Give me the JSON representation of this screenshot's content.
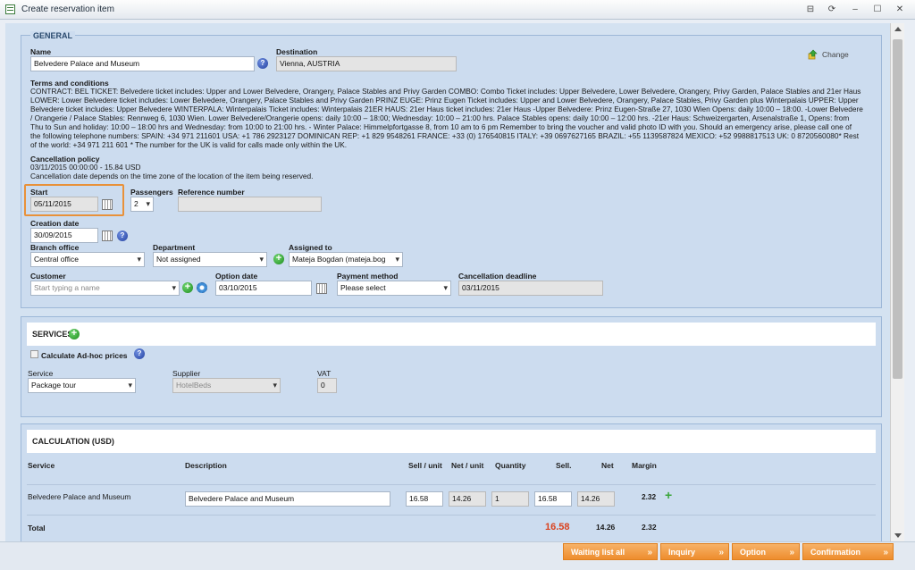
{
  "window": {
    "title": "Create reservation item",
    "controls": [
      "⊟",
      "⟳",
      "–",
      "☐",
      "✕"
    ]
  },
  "general": {
    "legend": "GENERAL",
    "change_label": "Change",
    "name_label": "Name",
    "name_value": "Belvedere Palace and Museum",
    "destination_label": "Destination",
    "destination_value": "Vienna, AUSTRIA",
    "terms_label": "Terms and conditions",
    "terms_text": "CONTRACT: BEL TICKET: Belvedere ticket includes: Upper and Lower Belvedere, Orangery, Palace Stables and Privy Garden COMBO: Combo Ticket includes: Upper Belvedere, Lower Belvedere, Orangery, Privy Garden, Palace Stables and 21er Haus LOWER: Lower Belvedere ticket includes: Lower Belvedere, Orangery, Palace Stables and Privy Garden PRINZ EUGE: Prinz Eugen Ticket includes: Upper and Lower Belvedere, Orangery, Palace Stables, Privy Garden plus Winterpalais UPPER: Upper Belvedere ticket includes: Upper Belvedere WINTERPALA: Winterpalais Ticket includes: Winterpalais 21ER HAUS: 21er Haus ticket includes: 21er Haus -Upper Belvedere: Prinz Eugen-Straße 27, 1030 Wien Opens: daily 10:00 – 18:00. -Lower Belvedere / Orangerie / Palace Stables: Rennweg 6, 1030 Wien. Lower Belvedere/Orangerie opens: daily 10:00 – 18:00; Wednesday: 10:00 – 21:00 hrs. Palace Stables opens: daily 10:00 – 12:00 hrs. -21er Haus: Schweizergarten, Arsenalstraße 1, Opens: from Thu to Sun and holiday: 10:00 – 18:00 hrs and Wednesday: from 10:00 to 21:00 hrs. - Winter Palace: Himmelpfortgasse 8, from 10 am to 6 pm Remember to bring the voucher and valid photo ID with you. Should an emergency arise, please call one of the following telephone numbers: SPAIN: +34 971 211601 USA: +1 786 2923127 DOMINICAN REP: +1 829 9548261 FRANCE: +33 (0) 176540815 ITALY: +39 0697627165 BRAZIL: +55 1139587824 MEXICO: +52 9988817513 UK: 0 8720560080* Rest of the world: +34 971 211 601 * The number for the UK is valid for calls made only within the UK.",
    "cancel_policy_label": "Cancellation policy",
    "cancel_policy_line1": "03/11/2015 00:00:00 - 15.84 USD",
    "cancel_policy_line2": "Cancellation date depends on the time zone of the location of the item being reserved.",
    "start_label": "Start",
    "start_value": "05/11/2015",
    "passengers_label": "Passengers",
    "passengers_value": "2",
    "reference_label": "Reference number",
    "reference_value": "",
    "creation_label": "Creation date",
    "creation_value": "30/09/2015",
    "branch_label": "Branch office",
    "branch_value": "Central office",
    "department_label": "Department",
    "department_value": "Not assigned",
    "assigned_label": "Assigned to",
    "assigned_value": "Mateja Bogdan (mateja.bog",
    "customer_label": "Customer",
    "customer_placeholder": "Start typing a name",
    "option_date_label": "Option date",
    "option_date_value": "03/10/2015",
    "payment_label": "Payment method",
    "payment_value": "Please select",
    "cancel_deadline_label": "Cancellation deadline",
    "cancel_deadline_value": "03/11/2015"
  },
  "services": {
    "title": "SERVICES",
    "adhoc_label": "Calculate Ad-hoc prices",
    "service_label": "Service",
    "service_value": "Package tour",
    "supplier_label": "Supplier",
    "supplier_value": "HotelBeds",
    "vat_label": "VAT",
    "vat_value": "0"
  },
  "calculation": {
    "title": "CALCULATION (USD)",
    "headers": {
      "service": "Service",
      "description": "Description",
      "sell_unit": "Sell / unit",
      "net_unit": "Net / unit",
      "quantity": "Quantity",
      "sell": "Sell.",
      "net": "Net",
      "margin": "Margin"
    },
    "row": {
      "service": "Belvedere Palace and Museum",
      "description": "Belvedere Palace and Museum",
      "sell_unit": "16.58",
      "net_unit": "14.26",
      "quantity": "1",
      "sell": "16.58",
      "net": "14.26",
      "margin": "2.32"
    },
    "total": {
      "label": "Total",
      "sell": "16.58",
      "net": "14.26",
      "margin": "2.32"
    }
  },
  "actions": {
    "waiting": "Waiting list all",
    "inquiry": "Inquiry",
    "option": "Option",
    "confirmation": "Confirmation"
  },
  "colors": {
    "accent_orange": "#ee8d2e",
    "total_red": "#d9431f",
    "panel_blue": "#ccdcef"
  }
}
